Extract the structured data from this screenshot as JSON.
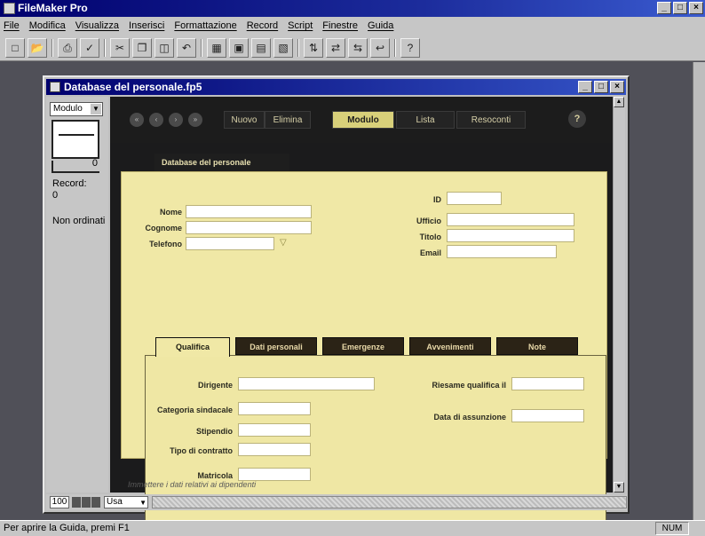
{
  "app": {
    "title": "FileMaker Pro",
    "window_buttons": [
      "_",
      "□",
      "×"
    ]
  },
  "menubar": {
    "items": [
      "File",
      "Modifica",
      "Visualizza",
      "Inserisci",
      "Formattazione",
      "Record",
      "Script",
      "Finestre",
      "Guida"
    ]
  },
  "toolbar": {
    "icons": [
      "new-doc-icon",
      "open-folder-icon",
      "print-icon",
      "spellcheck-icon",
      "cut-icon",
      "copy-icon",
      "paste-icon",
      "undo-icon",
      "browse-icon",
      "find-icon",
      "layout-icon",
      "preview-icon",
      "sort-icon",
      "replace-icon",
      "lookup-icon",
      "help-icon"
    ]
  },
  "document": {
    "title": "Database del personale.fp5",
    "mode": "Modulo",
    "slider_value": "0",
    "record_label": "Record:",
    "record_count": "0",
    "sort_status": "Non ordinati",
    "zoom": "100",
    "view_mode": "Usa",
    "hint": "Immettere i dati relativi ai dipendenti"
  },
  "nav": {
    "arrows": [
      "«",
      "‹",
      "›",
      "»"
    ],
    "buttons": [
      "Nuovo",
      "Elimina",
      "Modulo",
      "Lista",
      "Resoconti"
    ],
    "active": "Modulo",
    "help": "?"
  },
  "form": {
    "card_title": "Database del personale",
    "fields_left": [
      {
        "label": "Nome",
        "value": ""
      },
      {
        "label": "Cognome",
        "value": ""
      },
      {
        "label": "Telefono",
        "value": ""
      }
    ],
    "fields_right": [
      {
        "label": "ID",
        "value": ""
      },
      {
        "label": "Ufficio",
        "value": ""
      },
      {
        "label": "Titolo",
        "value": ""
      },
      {
        "label": "Email",
        "value": ""
      }
    ],
    "tabs": [
      "Qualifica",
      "Dati personali",
      "Emergenze",
      "Avvenimenti",
      "Note"
    ],
    "active_tab": "Qualifica",
    "qualifica_left": [
      {
        "label": "Dirigente",
        "value": ""
      },
      {
        "label": "Categoria sindacale",
        "value": ""
      },
      {
        "label": "Stipendio",
        "value": ""
      },
      {
        "label": "Tipo di contratto",
        "value": ""
      },
      {
        "label": "Matricola",
        "value": ""
      }
    ],
    "qualifica_right": [
      {
        "label": "Riesame qualifica il",
        "value": ""
      },
      {
        "label": "Data di assunzione",
        "value": ""
      }
    ]
  },
  "statusbar": {
    "text": "Per aprire la Guida, premi F1",
    "num": "NUM"
  }
}
